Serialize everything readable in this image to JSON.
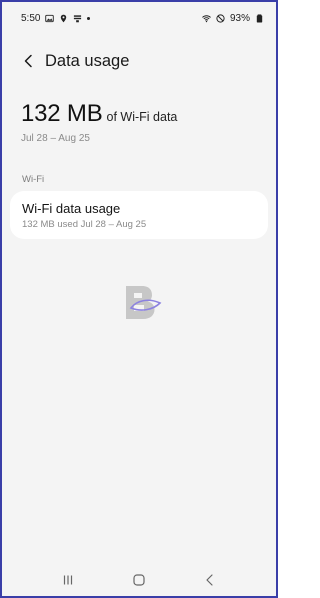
{
  "status_bar": {
    "time": "5:50",
    "battery": "93%",
    "left_icons": [
      "image-icon",
      "location-icon",
      "data-saver-icon",
      "dot-icon"
    ],
    "right_icons": [
      "wifi-icon",
      "do-not-disturb-icon",
      "battery-icon"
    ]
  },
  "header": {
    "title": "Data usage",
    "back_icon": "chevron-left-icon"
  },
  "summary": {
    "amount": "132 MB",
    "suffix": "of Wi-Fi data",
    "period": "Jul 28 – Aug 25"
  },
  "section": {
    "label": "Wi-Fi"
  },
  "wifi_card": {
    "title": "Wi-Fi data usage",
    "subtitle": "132 MB used Jul 28 – Aug 25"
  },
  "nav_bar": {
    "items": [
      "recent-apps-icon",
      "home-icon",
      "back-icon"
    ]
  },
  "colors": {
    "background": "#f4f4f4",
    "card": "#ffffff",
    "frame_border": "#3a3ea8",
    "primary_text": "#111111",
    "secondary_text": "#8a8a8a"
  }
}
